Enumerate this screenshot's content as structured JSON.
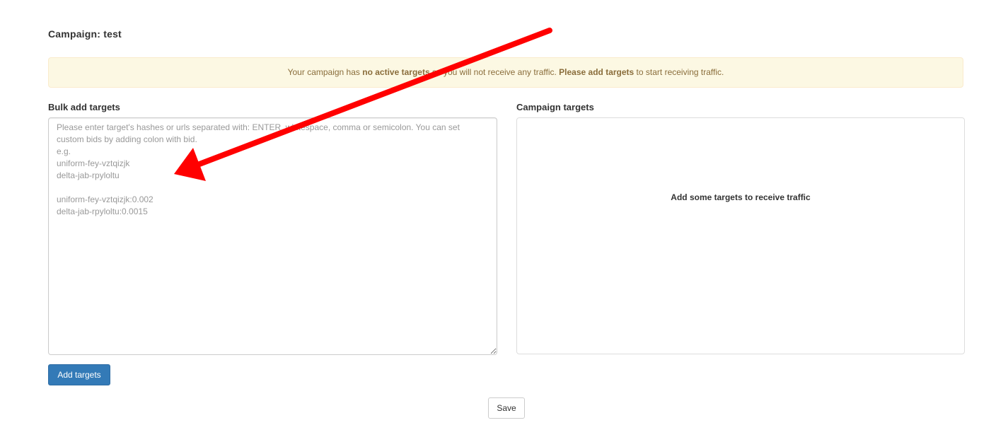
{
  "page": {
    "title": "Campaign: test"
  },
  "alert": {
    "part1": "Your campaign has ",
    "part2_bold": "no active targets",
    "part3": " so you will not receive any traffic. ",
    "part4_bold": "Please add targets",
    "part5": " to start receiving traffic."
  },
  "bulk_add": {
    "label": "Bulk add targets",
    "placeholder": "Please enter target's hashes or urls separated with: ENTER, whitespace, comma or semicolon. You can set custom bids by adding colon with bid.\ne.g.\nuniform-fey-vztqizjk\ndelta-jab-rpyloltu\n\nuniform-fey-vztqizjk:0.002\ndelta-jab-rpyloltu:0.0015",
    "value": ""
  },
  "campaign_targets": {
    "label": "Campaign targets",
    "empty_message": "Add some targets to receive traffic"
  },
  "buttons": {
    "add_targets": "Add targets",
    "save": "Save"
  },
  "annotation": {
    "arrow_color": "#ff0000",
    "icon": "red-arrow-icon"
  },
  "colors": {
    "primary": "#337ab7",
    "warning_bg": "#fcf8e3",
    "warning_text": "#8a6d3b"
  }
}
